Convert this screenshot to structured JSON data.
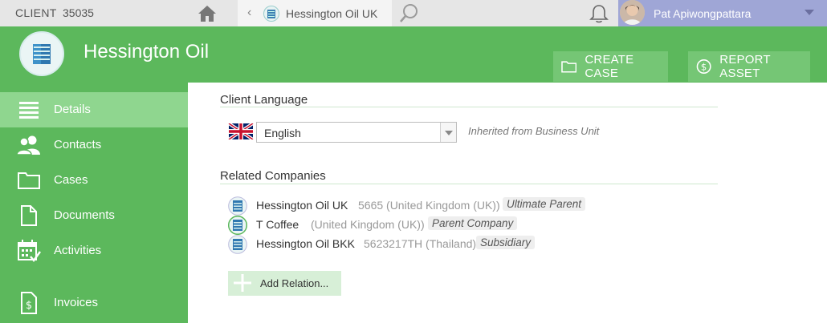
{
  "topbar": {
    "client_label": "CLIENT",
    "client_id": "35035",
    "tab_label": "Hessington Oil UK",
    "user_name": "Pat Apiwongpattara"
  },
  "header": {
    "title": "Hessington Oil",
    "create_case_label": "CREATE CASE",
    "report_asset_label": "REPORT ASSET"
  },
  "sidebar": {
    "items": [
      {
        "label": "Details",
        "icon": "list-icon",
        "active": true
      },
      {
        "label": "Contacts",
        "icon": "contacts-icon"
      },
      {
        "label": "Cases",
        "icon": "folder-icon"
      },
      {
        "label": "Documents",
        "icon": "document-icon"
      },
      {
        "label": "Activities",
        "icon": "calendar-check-icon"
      },
      {
        "label": "Invoices",
        "icon": "invoice-icon"
      }
    ]
  },
  "client_language": {
    "title": "Client Language",
    "selected": "English",
    "note": "Inherited from Business Unit",
    "flag": "uk-flag-icon"
  },
  "related_companies": {
    "title": "Related Companies",
    "items": [
      {
        "name": "Hessington Oil UK",
        "id": "5665 (United Kingdom (UK))",
        "type": "Ultimate Parent"
      },
      {
        "name": "T Coffee",
        "id": "(United Kingdom (UK))",
        "type": "Parent Company"
      },
      {
        "name": "Hessington Oil BKK",
        "id": "5623217TH (Thailand)",
        "type": "Subsidiary"
      }
    ],
    "add_label": "Add Relation..."
  },
  "colors": {
    "brand_green": "#5cb85c",
    "active_nav": "#8fd68f",
    "user_bar": "#9fa6d6"
  }
}
